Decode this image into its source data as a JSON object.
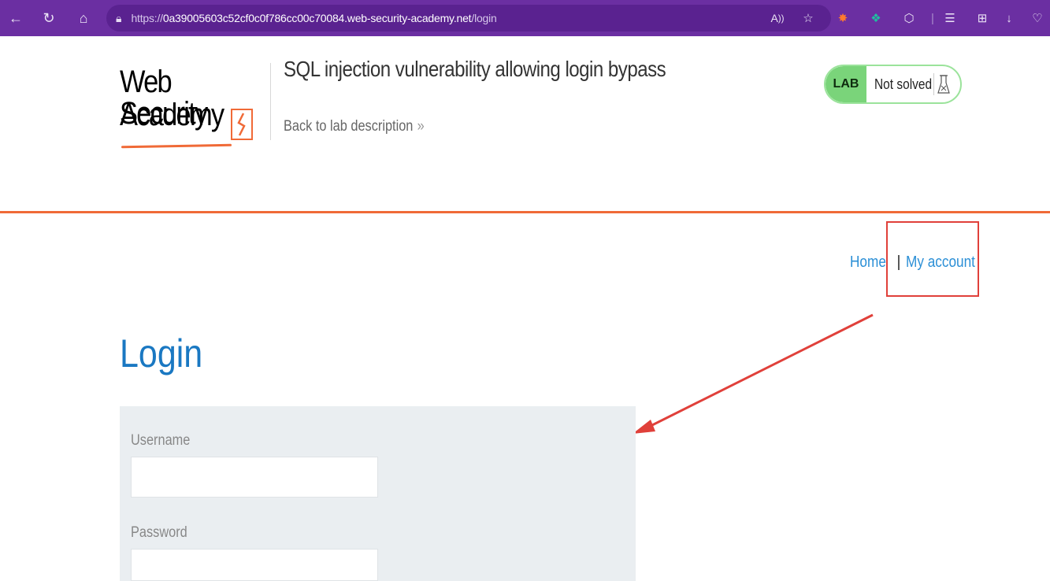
{
  "browser": {
    "url_prefix": "https://",
    "url_host": "0a39005603c52cf0c0f786cc00c70084.web-security-academy.net",
    "url_path": "/login"
  },
  "header": {
    "logo_line1": "Web Security",
    "logo_line2": "Academy",
    "lab_title": "SQL injection vulnerability allowing login bypass",
    "back_link": "Back to lab description",
    "back_chevron": "»",
    "lab_badge": "LAB",
    "lab_status": "Not solved"
  },
  "nav": {
    "home": "Home",
    "separator": "|",
    "my_account": "My account"
  },
  "login": {
    "heading": "Login",
    "username_label": "Username",
    "username_value": "",
    "password_label": "Password",
    "password_value": ""
  },
  "colors": {
    "browser_bar": "#6b2fa2",
    "accent_orange": "#f06a37",
    "link_blue": "#2b8fd6",
    "heading_blue": "#1a78c2",
    "panel_bg": "#eaeef1",
    "lab_green": "#7ad47a",
    "annotation_red": "#e0403a"
  },
  "icons": {
    "back": "arrow-left-icon",
    "refresh": "refresh-icon",
    "home": "home-icon",
    "site_info": "site-info-icon",
    "read_aloud": "read-aloud-icon",
    "favorite": "add-favorite-icon",
    "extensions": "extensions-icon",
    "favorites_list": "favorites-icon",
    "collections": "collections-icon",
    "downloads": "download-icon",
    "lab_flask": "flask-icon"
  }
}
